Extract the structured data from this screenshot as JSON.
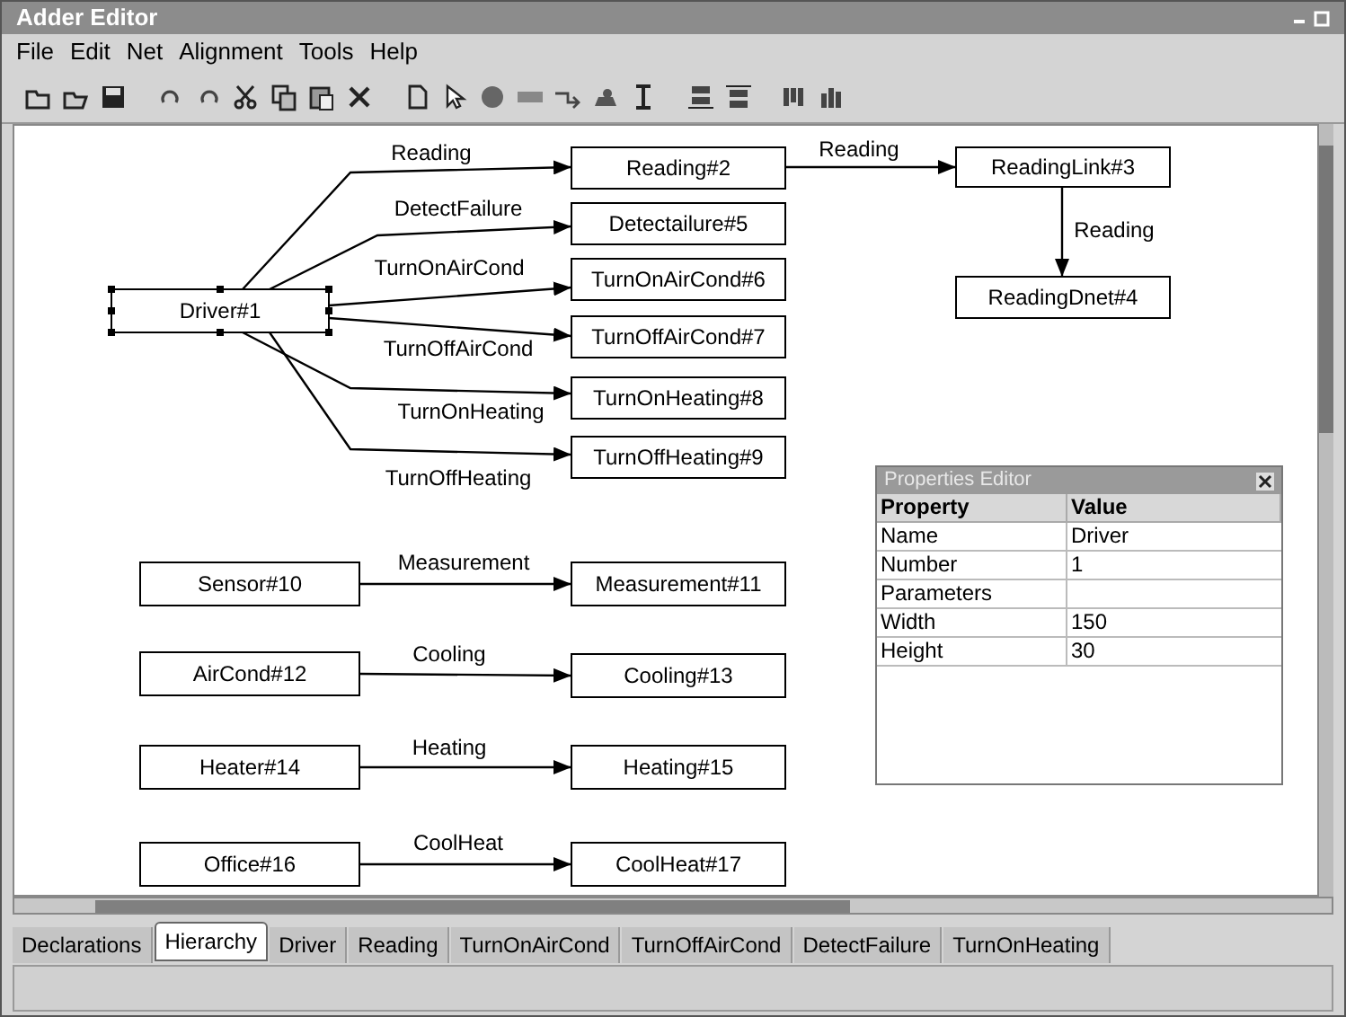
{
  "window": {
    "title": "Adder Editor"
  },
  "menu": [
    "File",
    "Edit",
    "Net",
    "Alignment",
    "Tools",
    "Help"
  ],
  "nodes": [
    {
      "label": "Driver#1",
      "selected": true
    },
    {
      "label": "Reading#2",
      "selected": false
    },
    {
      "label": "ReadingLink#3",
      "selected": false
    },
    {
      "label": "ReadingDnet#4",
      "selected": false
    },
    {
      "label": "Detectailure#5",
      "selected": false
    },
    {
      "label": "TurnOnAirCond#6",
      "selected": false
    },
    {
      "label": "TurnOffAirCond#7",
      "selected": false
    },
    {
      "label": "TurnOnHeating#8",
      "selected": false
    },
    {
      "label": "TurnOffHeating#9",
      "selected": false
    },
    {
      "label": "Sensor#10",
      "selected": false
    },
    {
      "label": "Measurement#11",
      "selected": false
    },
    {
      "label": "AirCond#12",
      "selected": false
    },
    {
      "label": "Cooling#13",
      "selected": false
    },
    {
      "label": "Heater#14",
      "selected": false
    },
    {
      "label": "Heating#15",
      "selected": false
    },
    {
      "label": "Office#16",
      "selected": false
    },
    {
      "label": "CoolHeat#17",
      "selected": false
    }
  ],
  "edges": [
    {
      "label": "Reading"
    },
    {
      "label": "DetectFailure"
    },
    {
      "label": "TurnOnAirCond"
    },
    {
      "label": "TurnOffAirCond"
    },
    {
      "label": "TurnOnHeating"
    },
    {
      "label": "TurnOffHeating"
    },
    {
      "label": "Reading"
    },
    {
      "label": "Reading"
    },
    {
      "label": "Measurement"
    },
    {
      "label": "Cooling"
    },
    {
      "label": "Heating"
    },
    {
      "label": "CoolHeat"
    }
  ],
  "properties_editor": {
    "title": "Properties Editor",
    "columns": [
      "Property",
      "Value"
    ],
    "rows": [
      {
        "property": "Name",
        "value": "Driver"
      },
      {
        "property": "Number",
        "value": "1"
      },
      {
        "property": "Parameters"
      },
      {
        "property": "Width",
        "value": "150"
      },
      {
        "property": "Height",
        "value": "30"
      }
    ]
  },
  "tabs": [
    {
      "label": "Declarations",
      "selected": false
    },
    {
      "label": "Hierarchy",
      "selected": true
    },
    {
      "label": "Driver",
      "selected": false
    },
    {
      "label": "Reading",
      "selected": false
    },
    {
      "label": "TurnOnAirCond",
      "selected": false
    },
    {
      "label": "TurnOffAirCond",
      "selected": false
    },
    {
      "label": "DetectFailure",
      "selected": false
    },
    {
      "label": "TurnOnHeating",
      "selected": false
    }
  ]
}
